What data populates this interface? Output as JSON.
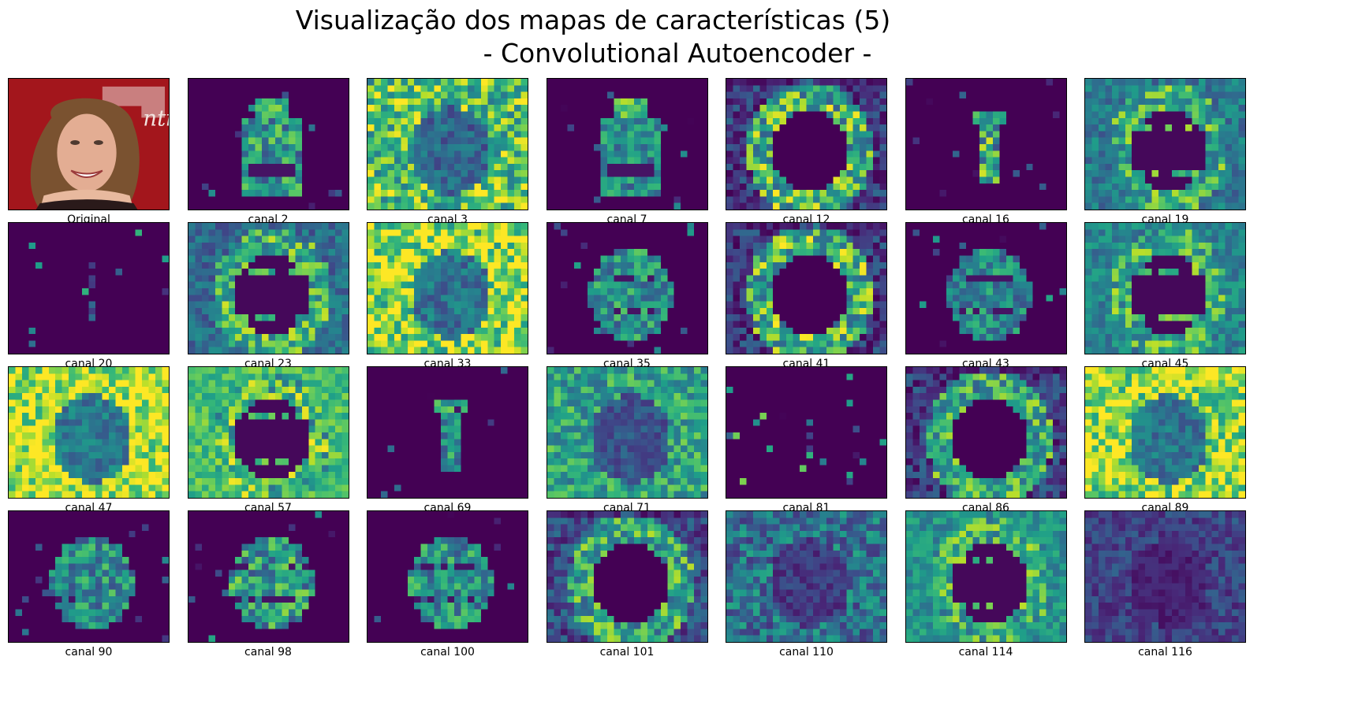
{
  "figure": {
    "title_line1": "Visualização dos mapas de características (5)",
    "title_line2": "- Convolutional Autoencoder -"
  },
  "colormap": "viridis",
  "colors": {
    "viridis_dark": "#440154",
    "viridis_mid": "#21908c",
    "viridis_bright": "#fde725",
    "photo_background": "#a3161c",
    "skin": "#e3ad93",
    "hair": "#7a5230"
  },
  "panels": [
    {
      "label": "Original",
      "kind": "photo"
    },
    {
      "label": "canal 2",
      "kind": "map",
      "pattern": "face",
      "bg": 0.0,
      "intensity": 0.55,
      "seed": 2
    },
    {
      "label": "canal 3",
      "kind": "map",
      "pattern": "field",
      "bg": 0.4,
      "intensity": 0.65,
      "seed": 3
    },
    {
      "label": "canal 7",
      "kind": "map",
      "pattern": "face",
      "bg": 0.0,
      "intensity": 0.45,
      "seed": 7
    },
    {
      "label": "canal 12",
      "kind": "map",
      "pattern": "ring",
      "bg": 0.0,
      "intensity": 0.7,
      "seed": 12
    },
    {
      "label": "canal 16",
      "kind": "map",
      "pattern": "nose",
      "bg": 0.0,
      "intensity": 0.7,
      "seed": 16
    },
    {
      "label": "canal 19",
      "kind": "map",
      "pattern": "ringfield",
      "bg": 0.25,
      "intensity": 0.55,
      "seed": 19
    },
    {
      "label": "canal 20",
      "kind": "map",
      "pattern": "sparse",
      "bg": 0.0,
      "intensity": 0.3,
      "seed": 20
    },
    {
      "label": "canal 23",
      "kind": "map",
      "pattern": "ringfield",
      "bg": 0.2,
      "intensity": 0.6,
      "seed": 23
    },
    {
      "label": "canal 33",
      "kind": "map",
      "pattern": "field",
      "bg": 0.5,
      "intensity": 0.7,
      "seed": 33
    },
    {
      "label": "canal 35",
      "kind": "map",
      "pattern": "faceblob",
      "bg": 0.0,
      "intensity": 0.5,
      "seed": 35
    },
    {
      "label": "canal 41",
      "kind": "map",
      "pattern": "ring",
      "bg": 0.0,
      "intensity": 0.7,
      "seed": 41
    },
    {
      "label": "canal 43",
      "kind": "map",
      "pattern": "faceblob",
      "bg": 0.0,
      "intensity": 0.45,
      "seed": 43
    },
    {
      "label": "canal 45",
      "kind": "map",
      "pattern": "ringfield",
      "bg": 0.3,
      "intensity": 0.55,
      "seed": 45
    },
    {
      "label": "canal 47",
      "kind": "map",
      "pattern": "field",
      "bg": 0.6,
      "intensity": 0.6,
      "seed": 47
    },
    {
      "label": "canal 57",
      "kind": "map",
      "pattern": "ringfield",
      "bg": 0.55,
      "intensity": 0.65,
      "seed": 57
    },
    {
      "label": "canal 69",
      "kind": "map",
      "pattern": "nose",
      "bg": 0.0,
      "intensity": 0.5,
      "seed": 69
    },
    {
      "label": "canal 71",
      "kind": "map",
      "pattern": "field",
      "bg": 0.35,
      "intensity": 0.45,
      "seed": 71
    },
    {
      "label": "canal 81",
      "kind": "map",
      "pattern": "sparse",
      "bg": 0.0,
      "intensity": 0.55,
      "seed": 81
    },
    {
      "label": "canal 86",
      "kind": "map",
      "pattern": "ring",
      "bg": 0.0,
      "intensity": 0.6,
      "seed": 86
    },
    {
      "label": "canal 89",
      "kind": "map",
      "pattern": "field",
      "bg": 0.55,
      "intensity": 0.6,
      "seed": 89
    },
    {
      "label": "canal 90",
      "kind": "map",
      "pattern": "faceblob",
      "bg": 0.0,
      "intensity": 0.5,
      "seed": 90
    },
    {
      "label": "canal 98",
      "kind": "map",
      "pattern": "faceblob",
      "bg": 0.0,
      "intensity": 0.6,
      "seed": 98
    },
    {
      "label": "canal 100",
      "kind": "map",
      "pattern": "faceblob",
      "bg": 0.0,
      "intensity": 0.5,
      "seed": 100
    },
    {
      "label": "canal 101",
      "kind": "map",
      "pattern": "ring",
      "bg": 0.05,
      "intensity": 0.6,
      "seed": 101
    },
    {
      "label": "canal 110",
      "kind": "map",
      "pattern": "field",
      "bg": 0.15,
      "intensity": 0.45,
      "seed": 110
    },
    {
      "label": "canal 114",
      "kind": "map",
      "pattern": "ringfield",
      "bg": 0.35,
      "intensity": 0.55,
      "seed": 114
    },
    {
      "label": "canal 116",
      "kind": "map",
      "pattern": "field",
      "bg": 0.08,
      "intensity": 0.25,
      "seed": 116
    }
  ]
}
